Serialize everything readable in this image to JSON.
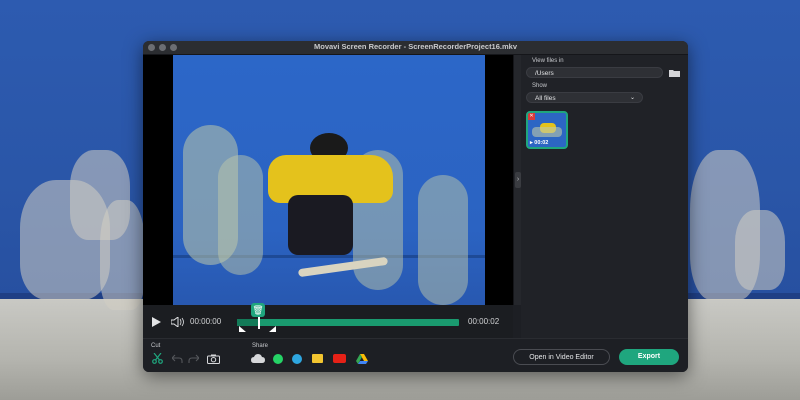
{
  "window": {
    "title": "Movavi Screen Recorder - ScreenRecorderProject16.mkv"
  },
  "panel": {
    "view_files_label": "View files in",
    "path_value": "/Users",
    "show_label": "Show",
    "show_value": "All files",
    "thumbnail": {
      "duration": "00:02"
    }
  },
  "player": {
    "current_time": "00:00:00",
    "total_time": "00:00:02"
  },
  "toolbar": {
    "cut_label": "Cut",
    "share_label": "Share",
    "open_editor_label": "Open in Video Editor",
    "export_label": "Export"
  },
  "colors": {
    "accent": "#1fa67e",
    "window_bg": "#1d1f24",
    "wall_blue": "#2d5bb0"
  },
  "icons": [
    "scissors-icon",
    "undo-icon",
    "redo-icon",
    "camera-icon",
    "cloud-icon",
    "whatsapp-icon",
    "telegram-icon",
    "folder-share-icon",
    "youtube-icon",
    "google-drive-icon",
    "play-icon",
    "volume-icon",
    "trash-icon",
    "folder-icon",
    "chevron-down-icon",
    "chevron-right-icon"
  ]
}
